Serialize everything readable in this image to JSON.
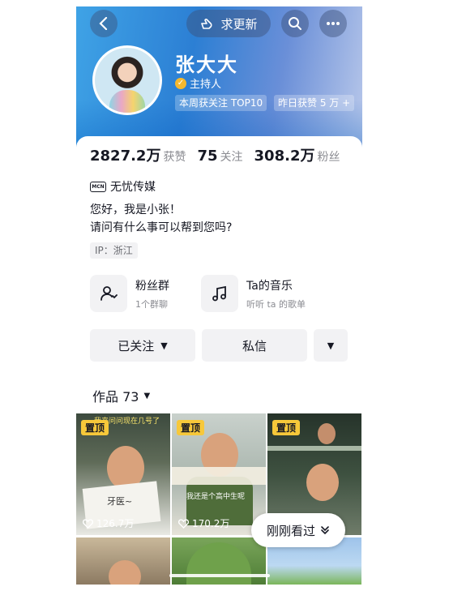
{
  "header": {
    "refresh_label": "求更新",
    "name": "张大大",
    "role": "主持人",
    "tags": [
      "本周获关注 TOP10",
      "昨日获赞 5 万 +"
    ]
  },
  "stats": {
    "likes_value": "2827.2万",
    "likes_label": "获赞",
    "following_value": "75",
    "following_label": "关注",
    "followers_value": "308.2万",
    "followers_label": "粉丝"
  },
  "mcn": {
    "badge": "MCN",
    "name": "无忧传媒"
  },
  "bio": {
    "line1": "您好，我是小张！",
    "line2": "请问有什么事可以帮到您吗?"
  },
  "ip": "IP：浙江",
  "features": [
    {
      "title": "粉丝群",
      "subtitle": "1个群聊",
      "icon": "fan-group-icon"
    },
    {
      "title": "Ta的音乐",
      "subtitle": "听听 ta 的歌单",
      "icon": "music-note-icon"
    }
  ],
  "actions": {
    "follow_label": "已关注",
    "message_label": "私信"
  },
  "works": {
    "label": "作品 73"
  },
  "videos": [
    {
      "pinned": "置顶",
      "likes": "126.7万",
      "caption_top": "我来问问现在几号了",
      "caption_mid": "牙医~"
    },
    {
      "pinned": "置顶",
      "likes": "170.2万",
      "caption_mid": "我还是个高中生呢"
    },
    {
      "pinned": "置顶"
    }
  ],
  "recently_viewed": "刚刚看过",
  "colors": {
    "accent_blue": "#2c7fd4",
    "pin_yellow": "#f7c83a",
    "verified_orange": "#f5b82e"
  }
}
